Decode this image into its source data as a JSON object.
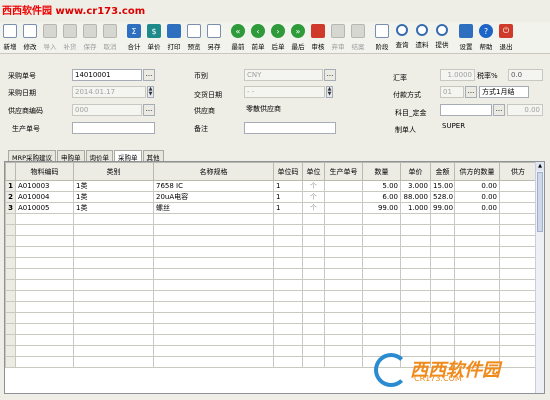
{
  "watermark": {
    "site": "西西软件园",
    "url": "www.cr173.com"
  },
  "toolbar": [
    {
      "name": "new",
      "label": "新增",
      "icon": "new-doc-icon",
      "enabled": true
    },
    {
      "name": "edit",
      "label": "修改",
      "icon": "edit-doc-icon",
      "enabled": true
    },
    {
      "name": "import",
      "label": "导入",
      "icon": "import-icon",
      "enabled": false
    },
    {
      "name": "copy",
      "label": "补货",
      "icon": "copy-icon",
      "enabled": false
    },
    {
      "name": "save",
      "label": "保存",
      "icon": "save-icon",
      "enabled": false
    },
    {
      "name": "cancel",
      "label": "取消",
      "icon": "cancel-icon",
      "enabled": false
    },
    {
      "name": "total",
      "label": "合计",
      "icon": "total-icon",
      "enabled": true
    },
    {
      "name": "price",
      "label": "单价",
      "icon": "price-icon",
      "enabled": true
    },
    {
      "name": "print",
      "label": "打印",
      "icon": "print-icon",
      "enabled": true
    },
    {
      "name": "preview",
      "label": "预览",
      "icon": "preview-icon",
      "enabled": true
    },
    {
      "name": "saveas",
      "label": "另存",
      "icon": "save-as-icon",
      "enabled": true
    },
    {
      "name": "first",
      "label": "最前",
      "icon": "first-arrow-icon",
      "enabled": true
    },
    {
      "name": "prev",
      "label": "前单",
      "icon": "prev-arrow-icon",
      "enabled": true
    },
    {
      "name": "next",
      "label": "后单",
      "icon": "next-arrow-icon",
      "enabled": true
    },
    {
      "name": "last",
      "label": "最后",
      "icon": "last-arrow-icon",
      "enabled": true
    },
    {
      "name": "audit",
      "label": "审核",
      "icon": "audit-icon",
      "enabled": true
    },
    {
      "name": "unaudit",
      "label": "弃审",
      "icon": "unaudit-icon",
      "enabled": false
    },
    {
      "name": "discard",
      "label": "结案",
      "icon": "discard-icon",
      "enabled": false
    },
    {
      "name": "stage",
      "label": "阶段",
      "icon": "stage-icon",
      "enabled": true
    },
    {
      "name": "query",
      "label": "查询",
      "icon": "search-icon",
      "enabled": true
    },
    {
      "name": "source",
      "label": "遗料",
      "icon": "source-icon",
      "enabled": true
    },
    {
      "name": "supply",
      "label": "提供",
      "icon": "supply-search-icon",
      "enabled": true
    },
    {
      "name": "settings",
      "label": "设置",
      "icon": "settings-icon",
      "enabled": true
    },
    {
      "name": "help",
      "label": "帮助",
      "icon": "help-icon",
      "enabled": true
    },
    {
      "name": "exit",
      "label": "退出",
      "icon": "exit-icon",
      "enabled": true
    }
  ],
  "form": {
    "po_no_label": "采购单号",
    "po_no": "14010001",
    "po_date_label": "采购日期",
    "po_date": "2014.01.17",
    "supplier_code_label": "供应商编码",
    "supplier_code": "000",
    "production_no_label": "生产单号",
    "production_no": "",
    "currency_label": "币别",
    "currency": "CNY",
    "delivery_date_label": "交货日期",
    "delivery_date": "- -",
    "supplier_label": "供应商",
    "supplier": "零散供应商",
    "remark_label": "备注",
    "remark": "",
    "rate_label": "汇率",
    "rate": "1.0000",
    "tax_label": "税率%",
    "tax": "0.0",
    "payment_label": "付款方式",
    "payment_code": "01",
    "payment": "方式1月结",
    "account_label": "科目_定金",
    "account": "",
    "deposit": "0.00",
    "maker_label": "制单人",
    "maker": "SUPER"
  },
  "tabs": [
    "MRP采购建议",
    "申购单",
    "询价单",
    "采购单",
    "其他"
  ],
  "active_tab": 3,
  "grid": {
    "columns": [
      "",
      "物料编码",
      "类别",
      "名称规格",
      "单位码",
      "单位",
      "生产单号",
      "数量",
      "单价",
      "金额",
      "供方的数量",
      "供方"
    ],
    "rows": [
      {
        "no": "1",
        "code": "A010003",
        "cat": "1类",
        "name": "7658 IC",
        "unit_code": "1",
        "unit": "个",
        "prod_no": "",
        "qty": "5.00",
        "price": "3.000",
        "amount": "15.00",
        "sup_qty": "0.00"
      },
      {
        "no": "2",
        "code": "A010004",
        "cat": "1类",
        "name": "20uA电容",
        "unit_code": "1",
        "unit": "个",
        "prod_no": "",
        "qty": "6.00",
        "price": "88.000",
        "amount": "528.0",
        "sup_qty": "0.00"
      },
      {
        "no": "3",
        "code": "A010005",
        "cat": "1类",
        "name": "螺丝",
        "unit_code": "1",
        "unit": "个",
        "prod_no": "",
        "qty": "99.00",
        "price": "1.000",
        "amount": "99.00",
        "sup_qty": "0.00"
      }
    ]
  },
  "logo": {
    "text": "西西软件园",
    "sub": "CR173.COM"
  }
}
